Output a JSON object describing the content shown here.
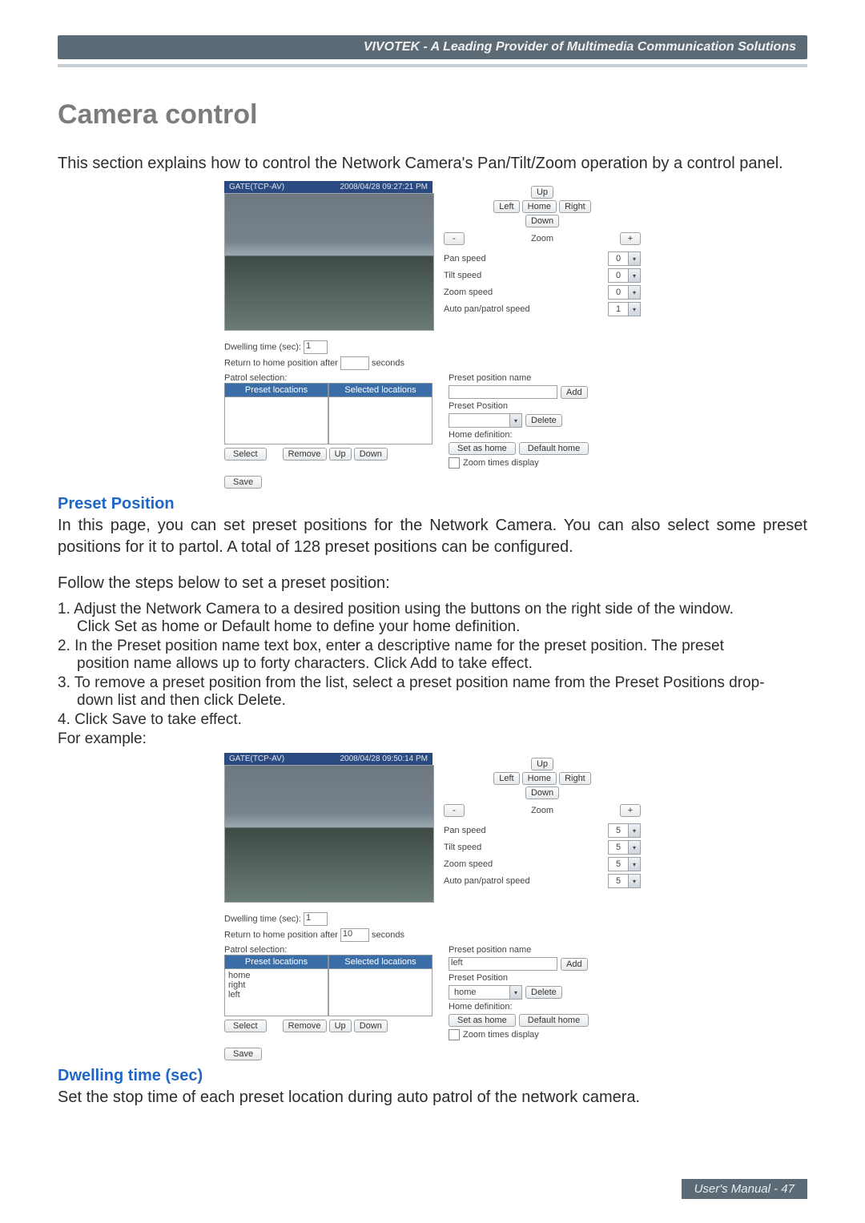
{
  "header": {
    "brand": "VIVOTEK - A Leading Provider of Multimedia Communication Solutions"
  },
  "title": "Camera control",
  "intro": "This section explains how to control the Network Camera's Pan/Tilt/Zoom operation by a control panel.",
  "sections": {
    "preset_position": {
      "heading": "Preset Position",
      "para": "In this page, you can set preset positions for the Network Camera. You can also select some preset positions for it to partol. A total of 128 preset positions can be configured.",
      "lead": "Follow the steps below to set a preset position:",
      "steps": {
        "s1a": "1. Adjust the Network Camera to a desired position using the buttons on the right side of the window.",
        "s1b": "Click Set as home or Default home to define your home definition.",
        "s2a": "2. In the Preset position name text box, enter a descriptive name for the preset position. The preset",
        "s2b": "position name allows up to forty characters. Click Add to take effect.",
        "s3a": "3. To remove a preset position from the list, select a preset position name from the Preset Positions drop-",
        "s3b": "down list and then click Delete.",
        "s4": "4. Click Save to take effect.",
        "example": "For example:"
      }
    },
    "dwelling": {
      "heading": "Dwelling time (sec)",
      "para": "Set the stop time of each preset location during auto patrol of the network camera."
    }
  },
  "panel_common": {
    "stream_name": "GATE(TCP-AV)",
    "buttons": {
      "up": "Up",
      "down": "Down",
      "left": "Left",
      "right": "Right",
      "home": "Home",
      "zoom_label": "Zoom",
      "minus": "-",
      "plus": "+",
      "add": "Add",
      "delete": "Delete",
      "set_as_home": "Set as home",
      "default_home": "Default home",
      "select": "Select",
      "remove": "Remove",
      "up_btn": "Up",
      "down_btn": "Down",
      "save": "Save"
    },
    "labels": {
      "pan_speed": "Pan speed",
      "tilt_speed": "Tilt speed",
      "zoom_speed": "Zoom speed",
      "auto_speed": "Auto pan/patrol speed",
      "dwelling": "Dwelling time (sec):",
      "return_home_a": "Return to home position after",
      "return_home_b": "seconds",
      "patrol_selection": "Patrol selection:",
      "preset_locations": "Preset locations",
      "selected_locations": "Selected locations",
      "preset_position_name": "Preset position name",
      "preset_position": "Preset Position",
      "home_definition": "Home definition:",
      "zoom_times": "Zoom times display"
    }
  },
  "panel1": {
    "timestamp": "2008/04/28 09:27:21 PM",
    "pan_speed": "0",
    "tilt_speed": "0",
    "zoom_speed": "0",
    "auto_speed": "1",
    "dwelling_value": "1",
    "return_home_value": "",
    "preset_name_value": "",
    "preset_select_value": "",
    "preset_list": [],
    "selected_list": []
  },
  "panel2": {
    "timestamp": "2008/04/28 09:50:14 PM",
    "pan_speed": "5",
    "tilt_speed": "5",
    "zoom_speed": "5",
    "auto_speed": "5",
    "dwelling_value": "1",
    "return_home_value": "10",
    "preset_name_value": "left",
    "preset_select_value": "home",
    "preset_list": [
      "home",
      "right",
      "left"
    ],
    "selected_list": []
  },
  "footer": "User's Manual - 47"
}
